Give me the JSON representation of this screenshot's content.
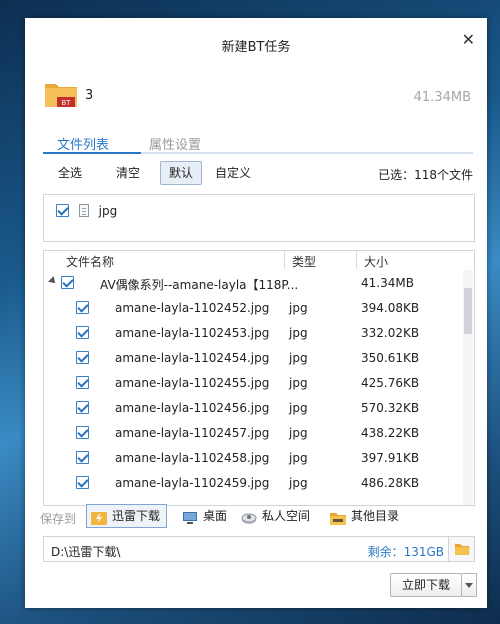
{
  "dialog": {
    "title": "新建BT任务",
    "close_symbol": "✕"
  },
  "task": {
    "icon_badge": "BT",
    "name": "3",
    "total_size": "41.34MB"
  },
  "tabs": [
    {
      "label": "文件列表",
      "active": true
    },
    {
      "label": "属性设置",
      "active": false
    }
  ],
  "filters": [
    {
      "label": "全选",
      "active": false
    },
    {
      "label": "清空",
      "active": false
    },
    {
      "label": "默认",
      "active": true
    },
    {
      "label": "自定义",
      "active": false
    }
  ],
  "selected_info": "已选：118个文件",
  "file_types": [
    {
      "label": "jpg",
      "checked": true
    }
  ],
  "columns": {
    "name": "文件名称",
    "type": "类型",
    "size": "大小"
  },
  "group": {
    "name": "AV偶像系列--amane-layla【118P...",
    "size": "41.34MB",
    "checked": true
  },
  "files": [
    {
      "name": "amane-layla-1102452.jpg",
      "type": "jpg",
      "size": "394.08KB",
      "checked": true
    },
    {
      "name": "amane-layla-1102453.jpg",
      "type": "jpg",
      "size": "332.02KB",
      "checked": true
    },
    {
      "name": "amane-layla-1102454.jpg",
      "type": "jpg",
      "size": "350.61KB",
      "checked": true
    },
    {
      "name": "amane-layla-1102455.jpg",
      "type": "jpg",
      "size": "425.76KB",
      "checked": true
    },
    {
      "name": "amane-layla-1102456.jpg",
      "type": "jpg",
      "size": "570.32KB",
      "checked": true
    },
    {
      "name": "amane-layla-1102457.jpg",
      "type": "jpg",
      "size": "438.22KB",
      "checked": true
    },
    {
      "name": "amane-layla-1102458.jpg",
      "type": "jpg",
      "size": "397.91KB",
      "checked": true
    },
    {
      "name": "amane-layla-1102459.jpg",
      "type": "jpg",
      "size": "486.28KB",
      "checked": true
    }
  ],
  "save": {
    "label": "保存到",
    "locations": [
      {
        "label": "迅雷下载",
        "icon": "thunder-download-icon",
        "active": true
      },
      {
        "label": "桌面",
        "icon": "desktop-icon",
        "active": false
      },
      {
        "label": "私人空间",
        "icon": "private-space-icon",
        "active": false
      },
      {
        "label": "其他目录",
        "icon": "folder-icon",
        "active": false
      }
    ],
    "path": "D:\\迅雷下载\\",
    "free_space": "剩余：131GB"
  },
  "actions": {
    "download_now": "立即下载"
  },
  "colors": {
    "accent": "#2a78c5",
    "folder": "#f0b54a",
    "badge": "#c62d2d"
  }
}
